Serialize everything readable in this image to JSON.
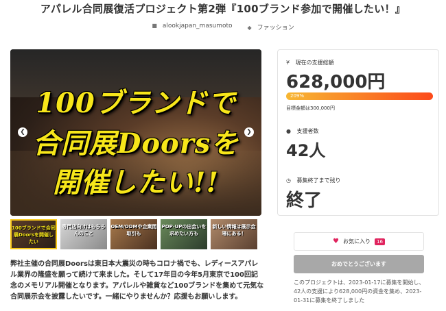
{
  "page": {
    "title": "アパレル合同展復活プロジェクト第2弾『100ブランド参加で開催したい！』",
    "author": "alookjapan_masumoto",
    "category": "ファッション"
  },
  "hero": {
    "line1": "100ブランドで",
    "line2": "合同展Doorsを",
    "line3": "開催したい!!",
    "prev_glyph": "❮",
    "next_glyph": "❯"
  },
  "thumbnails": [
    {
      "caption": "100ブランドで合同展Doorsを開催したい"
    },
    {
      "caption": "専門店向けはもちろんのこと"
    },
    {
      "caption": "OEM/ODMや企業間取引も"
    },
    {
      "caption": "POP-UPの出会いを求めたい方も"
    },
    {
      "caption": "新しい情報は展示会場にある！"
    }
  ],
  "description": "弊社主催の合同展Doorsは東日本大震災の時もコロナ禍でも、レディースアパレル業界の隆盛を願って続けて来ました。そして17年目の今年5月東京で100回記念のメモリアル開催となります。アパレルや雑貨など100ブランドを集めて元気な合同展示会を披露したいです。一緒にやりませんか？応援もお願いします。",
  "stats": {
    "funding_label": "現在の支援総額",
    "funding_icon": "yen-icon",
    "funding_value": "628,000円",
    "progress_text": "209%",
    "progress_percent": 209,
    "goal_text": "目標金額は300,000円",
    "backers_label": "支援者数",
    "backers_icon": "user-icon",
    "backers_value": "42人",
    "time_label": "募集終了まで残り",
    "time_icon": "clock-icon",
    "time_value": "終了"
  },
  "favorite": {
    "label": "お気に入り",
    "count": "16"
  },
  "status_button": "おめでとうございます",
  "closing_note": "このプロジェクトは、2023-01-17に募集を開始し、42人の支援により628,000円の資金を集め、2023-01-31に募集を終了しました",
  "colors": {
    "accent_gradient_start": "#f7b733",
    "accent_gradient_end": "#fc4a1a",
    "heart": "#e0245e",
    "hero_text": "#f7e61a"
  }
}
